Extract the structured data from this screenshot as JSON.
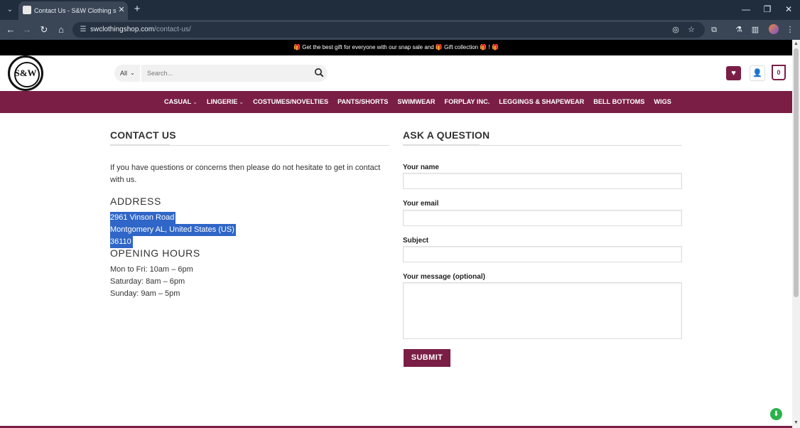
{
  "browser": {
    "tab_title": "Contact Us - S&W Clothing sh",
    "url_domain": "swclothingshop.com",
    "url_path": "/contact-us/"
  },
  "promo_text": "🎁 Get the best gift for everyone with our snap sale and 🎁 Gift collection 🎁 ! 🎁",
  "logo_text": "S&W",
  "search": {
    "category": "All",
    "placeholder": "Search..."
  },
  "header": {
    "cart_count": "0"
  },
  "nav": [
    {
      "label": "CASUAL",
      "has_dropdown": true
    },
    {
      "label": "LINGERIE",
      "has_dropdown": true
    },
    {
      "label": "COSTUMES/NOVELTIES",
      "has_dropdown": false
    },
    {
      "label": "PANTS/SHORTS",
      "has_dropdown": false
    },
    {
      "label": "SWIMWEAR",
      "has_dropdown": false
    },
    {
      "label": "FORPLAY INC.",
      "has_dropdown": false
    },
    {
      "label": "LEGGINGS & SHAPEWEAR",
      "has_dropdown": false
    },
    {
      "label": "BELL BOTTOMS",
      "has_dropdown": false
    },
    {
      "label": "WIGS",
      "has_dropdown": false
    }
  ],
  "contact": {
    "heading": "CONTACT US",
    "intro": "If you have questions or concerns then please do not hesitate to get in contact with us.",
    "address_heading": "ADDRESS",
    "address_lines": [
      "2961 Vinson Road",
      "Montgomery AL, United States (US)",
      "36110"
    ],
    "hours_heading": "OPENING HOURS",
    "hours_lines": [
      "Mon to Fri: 10am – 6pm",
      "Saturday: 8am – 6pm",
      "Sunday: 9am – 5pm"
    ]
  },
  "form": {
    "heading": "ASK A QUESTION",
    "name_label": "Your name",
    "email_label": "Your email",
    "subject_label": "Subject",
    "message_label": "Your message (optional)",
    "submit_label": "SUBMIT"
  },
  "colors": {
    "brand": "#7a1e46",
    "selection": "#2f66c7"
  }
}
